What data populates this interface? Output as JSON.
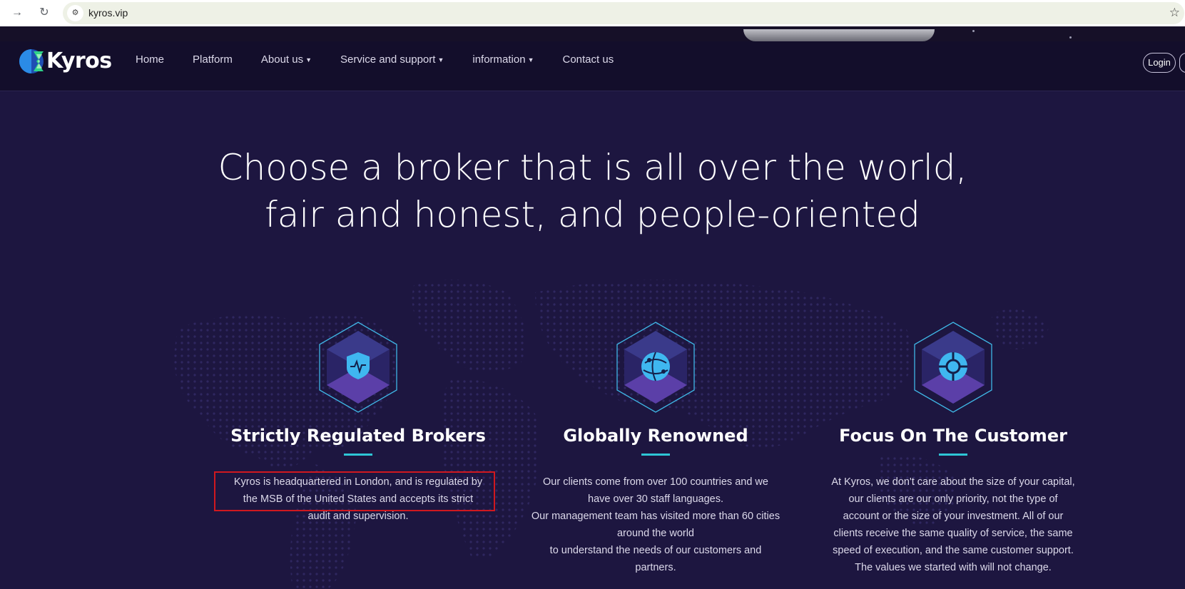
{
  "browser": {
    "url": "kyros.vip"
  },
  "nav": {
    "brand": "Kyros",
    "items": [
      {
        "label": "Home"
      },
      {
        "label": "Platform"
      },
      {
        "label": "About us",
        "dropdown": true
      },
      {
        "label": "Service and support",
        "dropdown": true
      },
      {
        "label": "information",
        "dropdown": true
      },
      {
        "label": "Contact us"
      }
    ],
    "login_label": "Login"
  },
  "hero": {
    "line1": "Choose a broker that is all over the world,",
    "line2": "fair and honest, and people-oriented"
  },
  "features": [
    {
      "icon": "pulse-shield-icon",
      "title": "Strictly Regulated Brokers",
      "description": "Kyros is headquartered in London, and is regulated by\nthe MSB of the United States and accepts its strict\naudit and supervision."
    },
    {
      "icon": "globe-network-icon",
      "title": "Globally Renowned",
      "description": "Our clients come from over 100 countries and we\nhave over 30 staff languages.\nOur management team has visited more than 60 cities\naround the world\nto understand the needs of our customers and\npartners."
    },
    {
      "icon": "target-circle-icon",
      "title": "Focus On The Customer",
      "description": "At Kyros, we don't care about the size of your capital,\nour clients are our only priority, not the type of\naccount or the size of your investment. All of our\nclients receive the same quality of service, the same\nspeed of execution, and the same customer support.\nThe values we started with will not change."
    }
  ],
  "colors": {
    "background": "#1d1640",
    "nav_background": "#130e2b",
    "accent_underline": "#2ec6d6",
    "highlight_border": "#d0181f"
  }
}
